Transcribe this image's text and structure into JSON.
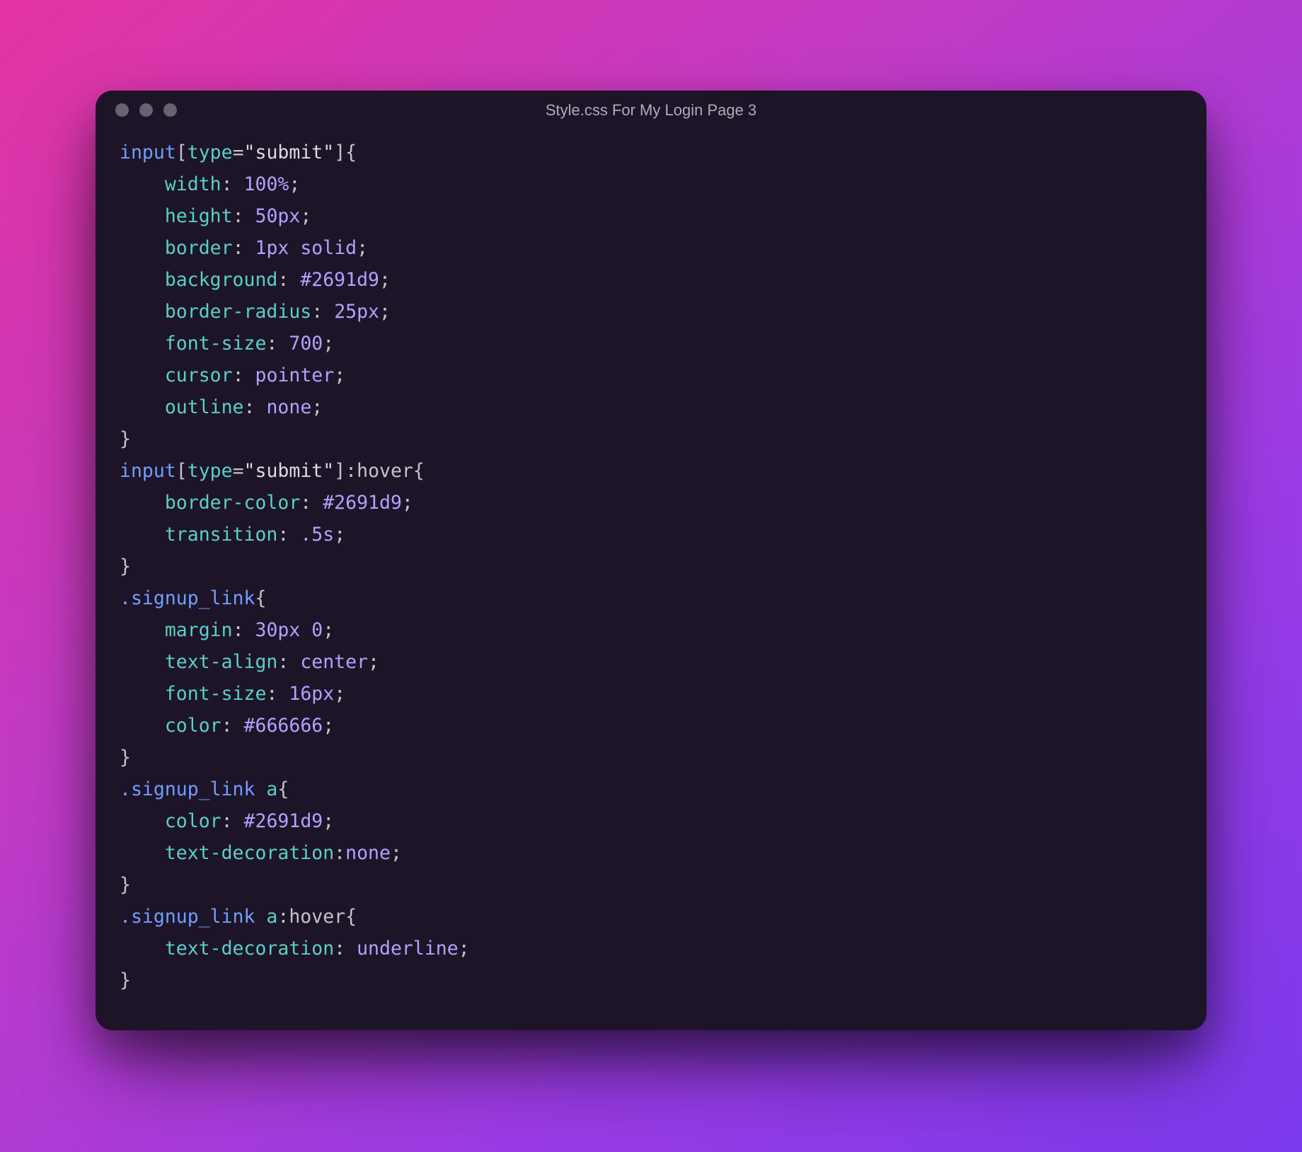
{
  "title": "Style.css For My Login Page 3",
  "code": {
    "s1": "input",
    "b1": "[",
    "a1": "type",
    "eq": "=",
    "q1": "\"submit\"",
    "b2": "]",
    "ob": "{",
    "p_width": "width",
    "c": ":",
    "sp": " ",
    "v_100pct": "100%",
    "sc": ";",
    "p_height": "height",
    "v_50px": "50px",
    "p_border": "border",
    "v_1px": "1px",
    "v_solid": "solid",
    "p_background": "background",
    "v_hex1": "#2691d9",
    "p_bradius": "border-radius",
    "v_25px": "25px",
    "p_fsize": "font-size",
    "v_700": "700",
    "p_cursor": "cursor",
    "v_pointer": "pointer",
    "p_outline": "outline",
    "v_none": "none",
    "cb": "}",
    "hover": ":hover",
    "p_bcolor": "border-color",
    "p_transition": "transition",
    "v_5s": ".5s",
    "cls_signup": ".signup_link",
    "p_margin": "margin",
    "v_30px": "30px",
    "v_0": "0",
    "p_talign": "text-align",
    "v_center": "center",
    "v_16px": "16px",
    "p_color": "color",
    "v_hex666": "#666666",
    "a": "a",
    "p_tdeco": "text-decoration",
    "v_underline": "underline"
  }
}
